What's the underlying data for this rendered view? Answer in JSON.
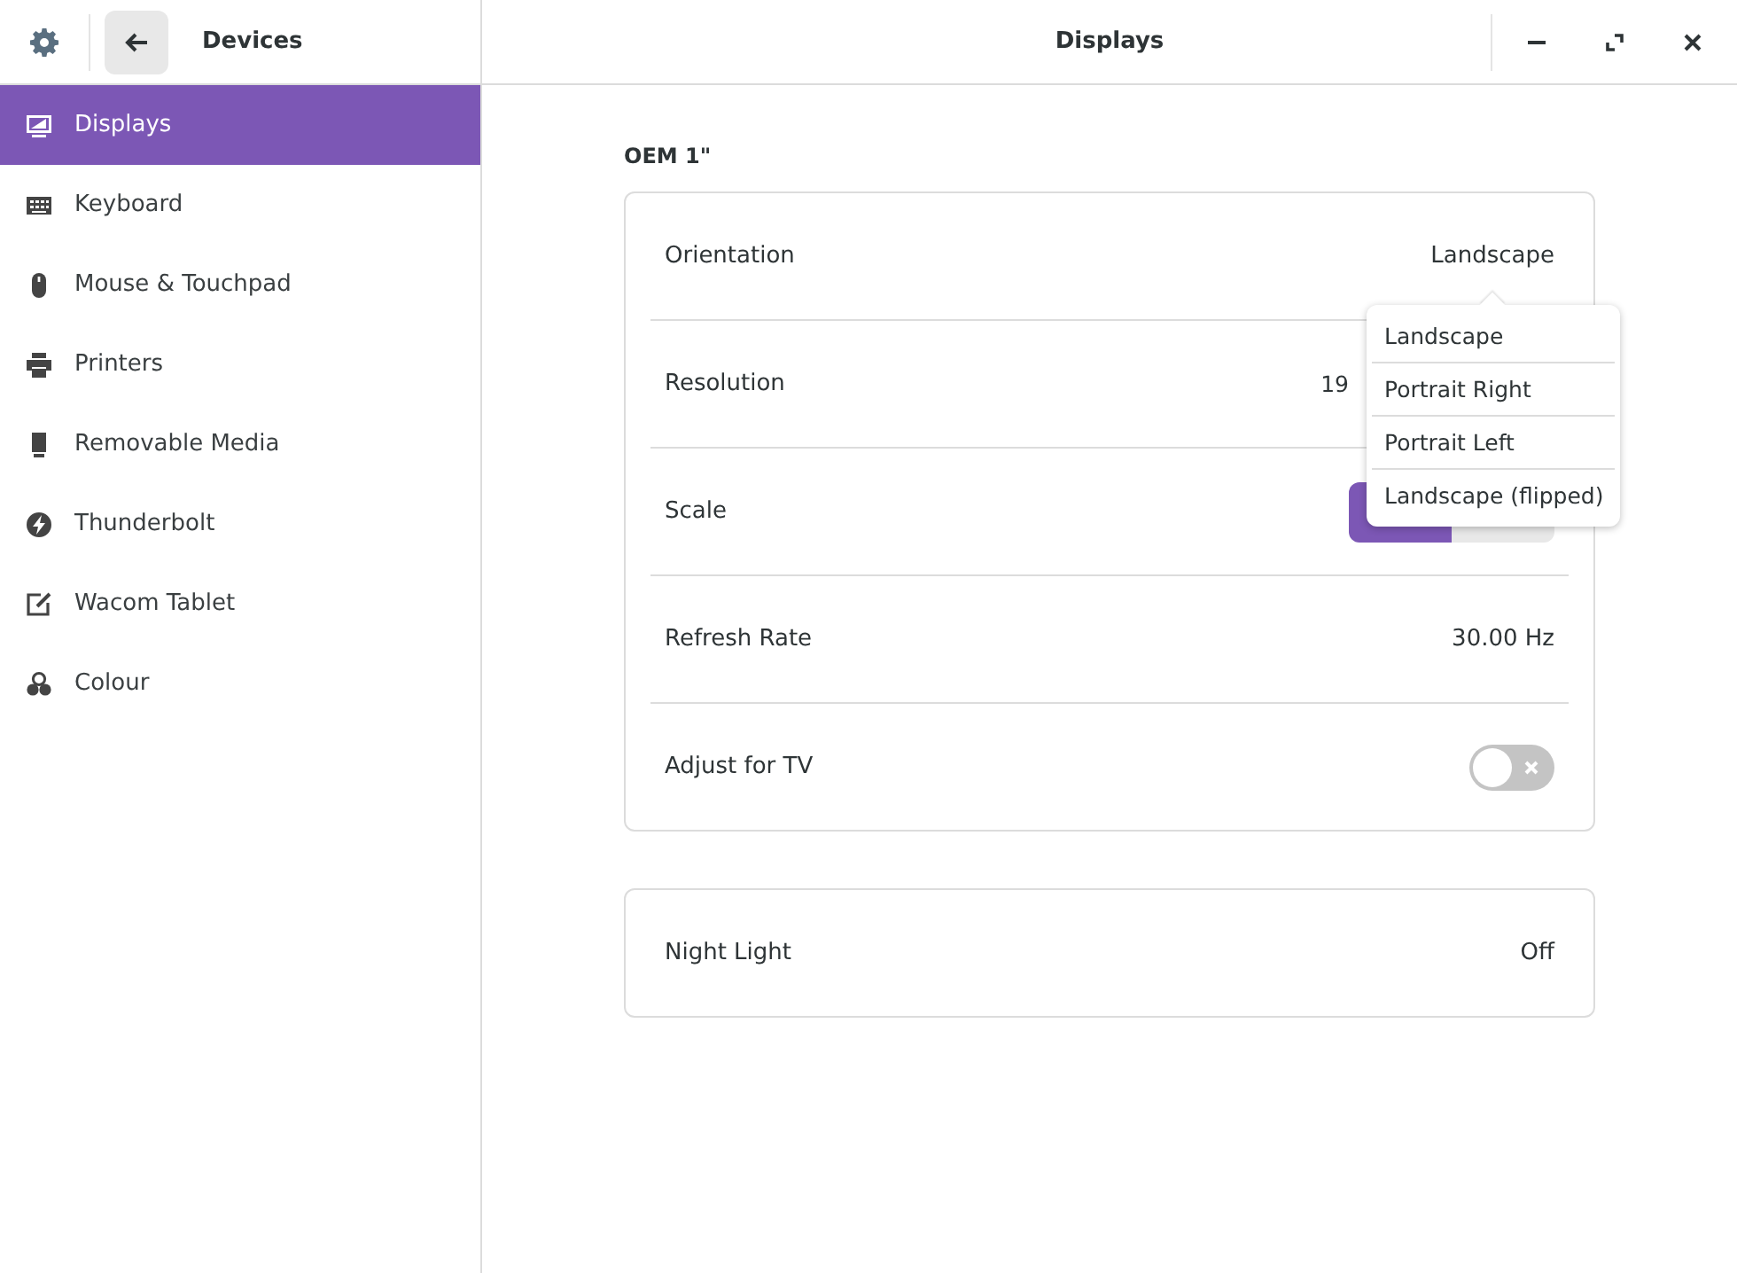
{
  "header": {
    "section_title": "Devices",
    "title": "Displays"
  },
  "sidebar": {
    "items": [
      {
        "label": "Displays",
        "selected": true
      },
      {
        "label": "Keyboard",
        "selected": false
      },
      {
        "label": "Mouse & Touchpad",
        "selected": false
      },
      {
        "label": "Printers",
        "selected": false
      },
      {
        "label": "Removable Media",
        "selected": false
      },
      {
        "label": "Thunderbolt",
        "selected": false
      },
      {
        "label": "Wacom Tablet",
        "selected": false
      },
      {
        "label": "Colour",
        "selected": false
      }
    ]
  },
  "display_name": "OEM 1\"",
  "settings": [
    {
      "kind": "value",
      "label": "Orientation",
      "value": "Landscape"
    },
    {
      "kind": "value",
      "label": "Resolution",
      "value": "19"
    },
    {
      "kind": "segments",
      "label": "Scale",
      "segments": [
        {
          "selected": true
        },
        {
          "selected": false
        }
      ]
    },
    {
      "kind": "value",
      "label": "Refresh Rate",
      "value": "30.00 Hz"
    },
    {
      "kind": "switch",
      "label": "Adjust for TV",
      "on": false
    }
  ],
  "night_light": {
    "label": "Night Light",
    "value": "Off"
  },
  "orientation_menu": {
    "options": [
      "Landscape",
      "Portrait Right",
      "Portrait Left",
      "Landscape (flipped)"
    ]
  }
}
